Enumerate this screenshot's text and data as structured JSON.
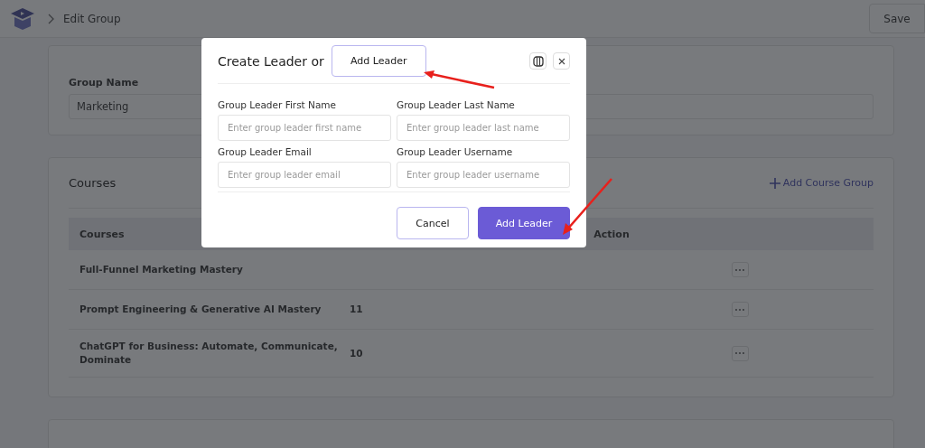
{
  "header": {
    "breadcrumb": "Edit Group",
    "save_button": "Save"
  },
  "group_card": {
    "label": "Group Name",
    "value": "Marketing"
  },
  "courses_card": {
    "title": "Courses",
    "add_link": "Add Course Group",
    "columns": [
      "Courses",
      "Action"
    ],
    "rows": [
      {
        "course": "Full-Funnel Marketing Mastery"
      },
      {
        "course": "Prompt Engineering & Generative AI Mastery",
        "count": "11"
      },
      {
        "course": "ChatGPT for Business: Automate, Communicate, Dominate",
        "count": "10"
      }
    ]
  },
  "modal": {
    "title": "Create Leader or",
    "title_button": "Add Leader",
    "fields": [
      {
        "label": "Group Leader First Name",
        "placeholder": "Enter group leader first name"
      },
      {
        "label": "Group Leader Last Name",
        "placeholder": "Enter group leader last name"
      },
      {
        "label": "Group Leader Email",
        "placeholder": "Enter group leader email"
      },
      {
        "label": "Group Leader Username",
        "placeholder": "Enter group leader username"
      }
    ],
    "buttons": [
      {
        "label": "Cancel",
        "kind": "secondary"
      },
      {
        "label": "Add Leader",
        "kind": "primary"
      }
    ]
  }
}
